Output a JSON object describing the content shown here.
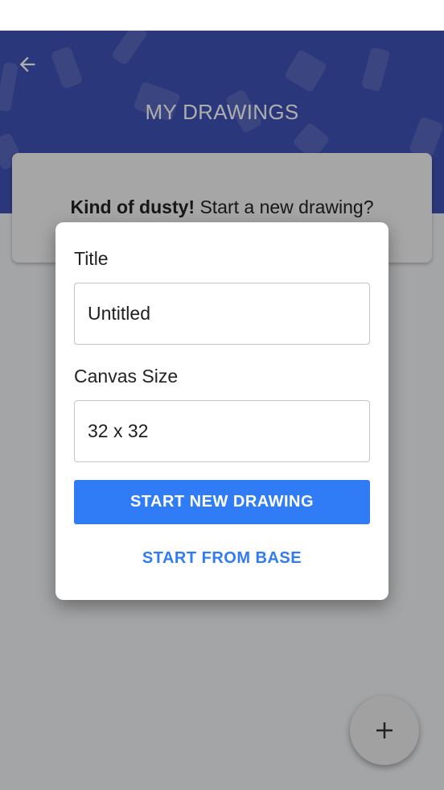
{
  "header": {
    "title": "MY DRAWINGS",
    "back_icon": "arrow-left-icon",
    "background_color": "#3f51b5"
  },
  "empty_state": {
    "bold_text": "Kind of dusty!",
    "text": " Start a new drawing?"
  },
  "dialog": {
    "title_label": "Title",
    "title_value": "Untitled",
    "canvas_size_label": "Canvas Size",
    "canvas_size_value": "32 x 32",
    "primary_button_label": "START NEW DRAWING",
    "secondary_button_label": "START FROM BASE",
    "accent_color": "#2f7cf6"
  },
  "fab": {
    "icon": "plus-icon"
  }
}
